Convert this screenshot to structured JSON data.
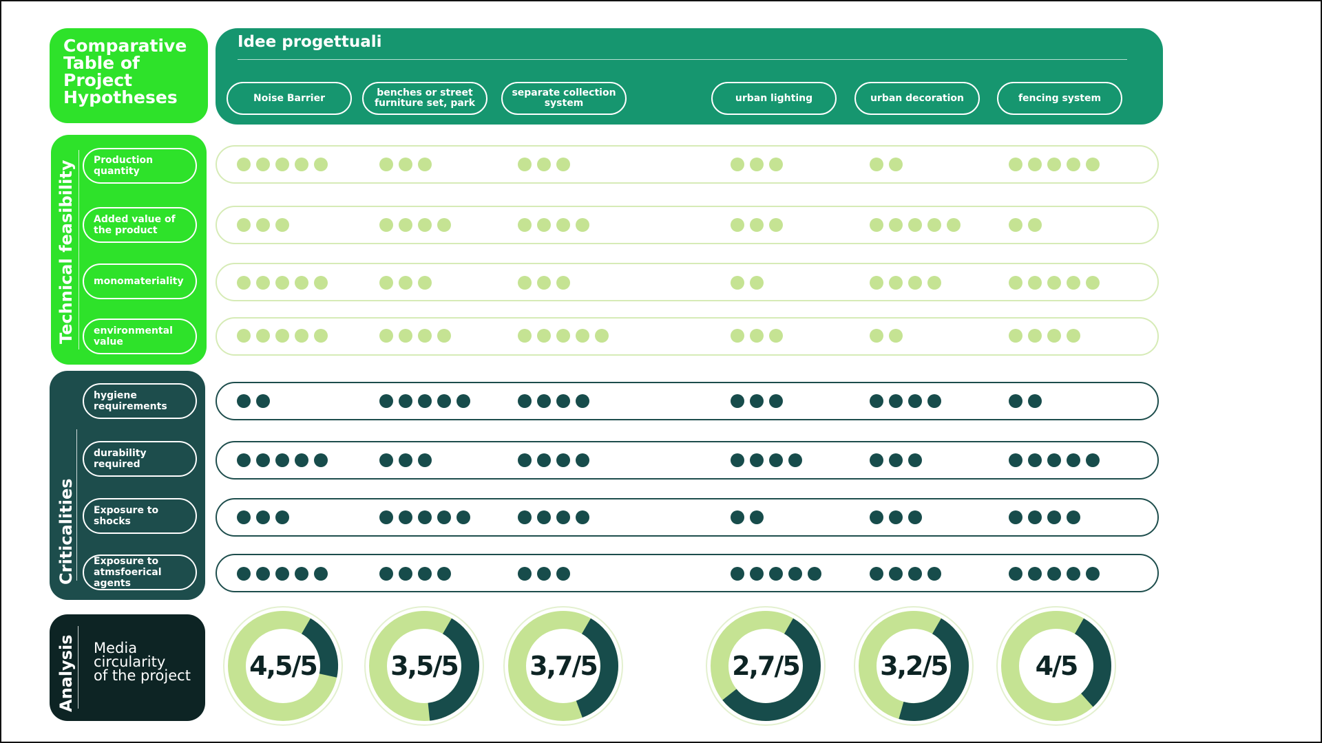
{
  "title_lines": [
    "Comparative",
    "Table of",
    "Project",
    "Hypotheses"
  ],
  "header": {
    "title": "Idee progettuali",
    "projects": [
      "Noise Barrier",
      "benches or street furniture set, park",
      "separate collection system",
      "urban lighting",
      "urban decoration",
      "fencing system"
    ]
  },
  "sections": {
    "technical": {
      "title": "Technical feasibility",
      "rows": [
        {
          "label": "Production quantity",
          "scores": [
            5,
            3,
            3,
            3,
            2,
            5
          ]
        },
        {
          "label": "Added value of the product",
          "scores": [
            3,
            4,
            4,
            3,
            5,
            2
          ]
        },
        {
          "label": "monomateriality",
          "scores": [
            5,
            3,
            3,
            2,
            4,
            5
          ]
        },
        {
          "label": "environmental value",
          "scores": [
            5,
            4,
            5,
            3,
            2,
            4
          ]
        }
      ]
    },
    "criticalities": {
      "title": "Criticalities",
      "rows": [
        {
          "label": "hygiene requirements",
          "scores": [
            2,
            5,
            4,
            3,
            4,
            2
          ]
        },
        {
          "label": "durability required",
          "scores": [
            5,
            3,
            4,
            4,
            3,
            5
          ]
        },
        {
          "label": "Exposure to shocks",
          "scores": [
            3,
            5,
            4,
            2,
            3,
            4
          ]
        },
        {
          "label": "Exposure to atmsfoerical agents",
          "scores": [
            5,
            4,
            3,
            5,
            4,
            5
          ]
        }
      ]
    },
    "analysis": {
      "title": "Analysis",
      "label_lines": [
        "Media",
        "circularity",
        "of the project"
      ],
      "results": [
        {
          "label": "4,5/5",
          "value": 4.5
        },
        {
          "label": "3,5/5",
          "value": 3.5
        },
        {
          "label": "3,7/5",
          "value": 3.7
        },
        {
          "label": "2,7/5",
          "value": 2.7
        },
        {
          "label": "3,2/5",
          "value": 3.2
        },
        {
          "label": "4/5",
          "value": 4.0
        }
      ]
    }
  },
  "colors": {
    "bright_green": "#2ee22a",
    "header_green": "#16966f",
    "dark_teal": "#1d4d4c",
    "darkest": "#0d2424",
    "light_dot": "#c5e393",
    "dark_dot": "#174c4b"
  }
}
